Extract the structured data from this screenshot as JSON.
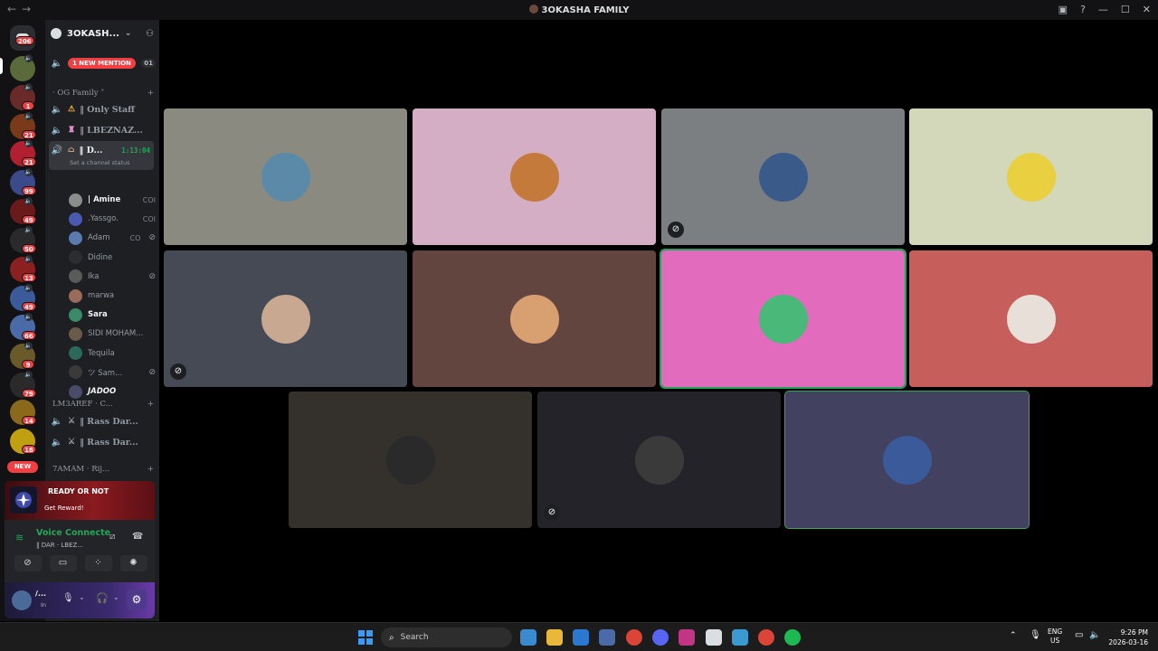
{
  "window": {
    "title": "3OKASHA FAMILY"
  },
  "guilds": {
    "dm_badge": "206",
    "badges": [
      "1",
      "21",
      "21",
      "99",
      "49",
      "50",
      "13",
      "49",
      "66",
      "9",
      "79",
      "14",
      "18"
    ],
    "new_label": "NEW"
  },
  "server": {
    "name": "3OKASH...",
    "new_mention": "1 NEW MENTION",
    "mention_count": "01"
  },
  "categories": [
    {
      "label": "· OG Family ˅"
    },
    {
      "label": "LM3AREF · C..."
    },
    {
      "label": "7AMAM · Rij..."
    }
  ],
  "channels": {
    "only_staff": "‖ Only Staff",
    "lbeznaz": "‖ LBEZNAZ...",
    "dar": "‖ D...",
    "dar_timer": "1:13:04",
    "dar_status": "Set a channel status",
    "rass1": "‖ Rass Dar...",
    "rass2": "‖ Rass Dar..."
  },
  "voice_users": [
    {
      "name": "| Amine",
      "tail": "COI",
      "bright": true
    },
    {
      "name": ".Yassgo.",
      "tail": "COI",
      "bright": false
    },
    {
      "name": "Adam",
      "tail": "CO",
      "bright": false
    },
    {
      "name": "Didine",
      "tail": "",
      "bright": false
    },
    {
      "name": "Ika",
      "tail": "",
      "bright": false
    },
    {
      "name": "marwa",
      "tail": "",
      "bright": false
    },
    {
      "name": "Sara",
      "tail": "",
      "bright": true
    },
    {
      "name": "SIDI MOHAM...",
      "tail": "",
      "bright": false
    },
    {
      "name": "Tequila",
      "tail": "",
      "bright": false
    },
    {
      "name": "ツ Sam...",
      "tail": "",
      "bright": false
    },
    {
      "name": "JADOO",
      "tail": "",
      "bright": true
    }
  ],
  "promo": {
    "title": "READY OR NOT",
    "cta": "Get Reward!"
  },
  "voice": {
    "status": "Voice Connecte",
    "location": "‖ DAR · LBEZ..."
  },
  "user": {
    "name": "/...",
    "status": "In"
  },
  "tile_colors": [
    "#8b8a80",
    "#d4aec4",
    "#7c7f82",
    "#d4d8bb",
    "#464a54",
    "#634540",
    "#e26bbd",
    "#c65f5c",
    "#34312d",
    "#25232a",
    "#42415f"
  ],
  "taskbar": {
    "search_placeholder": "Search",
    "lang": "ENG",
    "region": "US",
    "time": "9:26 PM",
    "date": "2026-03-16"
  }
}
